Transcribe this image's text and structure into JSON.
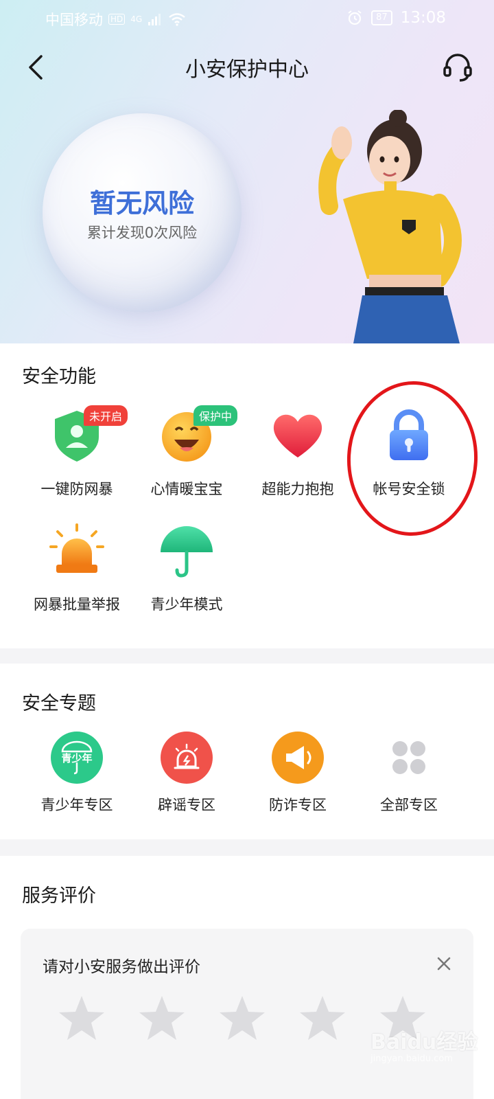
{
  "status_bar": {
    "carrier": "中国移动",
    "hd": "HD",
    "network": "4G",
    "battery": "87",
    "time": "13:08"
  },
  "navbar": {
    "title": "小安保护中心"
  },
  "hero": {
    "risk_title": "暂无风险",
    "risk_sub": "累计发现0次风险"
  },
  "security_features": {
    "title": "安全功能",
    "items": [
      {
        "label": "一键防网暴",
        "tag": "未开启",
        "icon": "shield-user-icon"
      },
      {
        "label": "心情暖宝宝",
        "tag": "保护中",
        "icon": "smile-face-icon"
      },
      {
        "label": "超能力抱抱",
        "icon": "heart-icon"
      },
      {
        "label": "帐号安全锁",
        "icon": "lock-icon"
      },
      {
        "label": "网暴批量举报",
        "icon": "alarm-light-icon"
      },
      {
        "label": "青少年模式",
        "icon": "umbrella-icon"
      }
    ]
  },
  "security_topics": {
    "title": "安全专题",
    "items": [
      {
        "label": "青少年专区",
        "badge": "青少年",
        "icon": "youth-umbrella-icon",
        "color": "#2cc98a"
      },
      {
        "label": "辟谣专区",
        "icon": "siren-icon",
        "color": "#f0524a"
      },
      {
        "label": "防诈专区",
        "icon": "megaphone-icon",
        "color": "#f59a1c"
      },
      {
        "label": "全部专区",
        "icon": "grid-dots-icon",
        "color": "#cfcfd3"
      }
    ]
  },
  "service_rating": {
    "title": "服务评价",
    "prompt": "请对小安服务做出评价",
    "stars": 5
  },
  "watermark": {
    "brand": "Baidu经验",
    "url": "jingyan.baidu.com"
  }
}
